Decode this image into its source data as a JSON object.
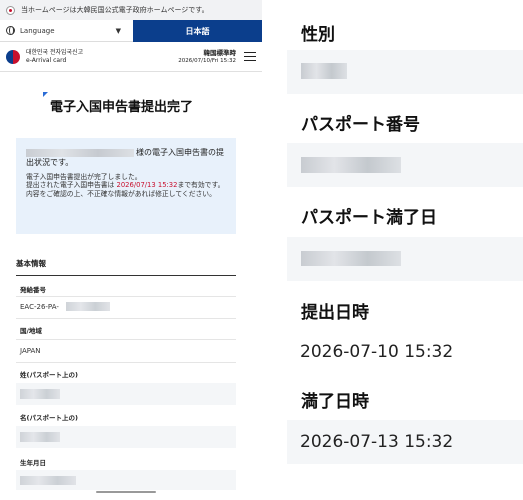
{
  "gov_banner": {
    "text": "当ホームページは大韓民国公式電子政府ホームページです。"
  },
  "language": {
    "label": "Language",
    "current": "日本語"
  },
  "brand": {
    "line1": "대한민국 전자입국신고",
    "line2": "e-Arrival card"
  },
  "clock": {
    "label": "韓国標準時",
    "datetime": "2026/07/10/Fri 15:32"
  },
  "page": {
    "title": "電子入国申告書提出完了"
  },
  "notice": {
    "head_suffix": "様の電子入国申告書の提出状況です。",
    "body_1": "電子入国申告書提出が完了しました。",
    "body_2a": "提出された電子入国申告書は ",
    "body_2_date": "2026/07/13 15:32",
    "body_2b": "まで有効です。内容をご確認の上、不正確な情報があれば修正してください。"
  },
  "basic_info": {
    "title": "基本情報",
    "issue_no_label": "発給番号",
    "issue_no_prefix": "EAC-26-PA-",
    "country_label": "国/地域",
    "country_value": "JAPAN",
    "surname_label": "姓(パスポート上の)",
    "given_label": "名(パスポート上の)",
    "dob_label": "生年月日"
  },
  "right_panel": {
    "gender_label": "性別",
    "passport_no_label": "パスポート番号",
    "passport_exp_label": "パスポート満了日",
    "submitted_label": "提出日時",
    "submitted_value": "2026-07-10 15:32",
    "expiry_label": "満了日時",
    "expiry_value": "2026-07-13 15:32"
  },
  "colors": {
    "brand_blue": "#0b3e8c",
    "highlight_red": "#c8102e",
    "notice_bg": "#e8f1fb"
  }
}
